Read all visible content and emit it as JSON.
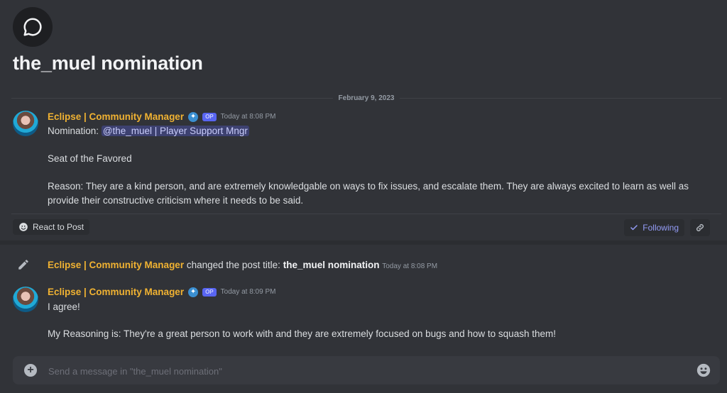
{
  "thread": {
    "title": "the_muel nomination",
    "date_divider": "February 9, 2023"
  },
  "messages": [
    {
      "author": "Eclipse | Community Manager",
      "badge": "OP",
      "timestamp": "Today at 8:08 PM",
      "nomination_prefix": "Nomination:",
      "mention": "@the_muel | Player Support Mngr",
      "line2": "Seat of the Favored",
      "line3": "Reason: They are a kind person, and are extremely knowledgable on ways to fix issues, and escalate them. They are always excited to learn as well as",
      "line4": "provide their constructive criticism where it needs to be said."
    },
    {
      "author": "Eclipse | Community Manager",
      "badge": "OP",
      "timestamp": "Today at 8:09 PM",
      "line1": "I agree!",
      "line2": "My Reasoning is: They're a great person to work with and they are extremely focused on bugs and how to squash them!"
    }
  ],
  "reactions": {
    "react_label": "React to Post",
    "following_label": "Following"
  },
  "system_message": {
    "author": "Eclipse | Community Manager",
    "action": "changed the post title:",
    "new_title": "the_muel nomination",
    "timestamp": "Today at 8:08 PM"
  },
  "composer": {
    "placeholder": "Send a message in \"the_muel nomination\""
  },
  "colors": {
    "background": "#313338",
    "username": "#f0b232",
    "mention_text": "#c9cdfb",
    "accent": "#5865f2"
  },
  "icons": [
    "forum-chat-icon",
    "role-icon",
    "react-emoji-icon",
    "check-icon",
    "link-icon",
    "pencil-icon",
    "plus-icon",
    "emoji-icon"
  ]
}
